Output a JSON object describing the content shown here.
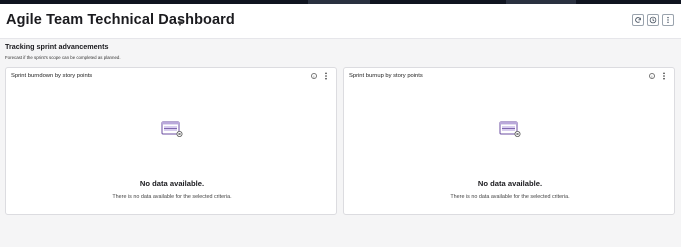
{
  "dashboard": {
    "title": "Agile Team Technical Dashboard",
    "caret_icon": "chevron-down-icon",
    "actions": [
      {
        "icon": "refresh-icon"
      },
      {
        "icon": "clock-icon"
      },
      {
        "icon": "kebab-menu-icon"
      }
    ]
  },
  "section": {
    "title": "Tracking sprint advancements",
    "subtitle": "Forecast if the sprint's scope can be completed as planned."
  },
  "cards": [
    {
      "title": "Sprint burndown by story points",
      "info_icon": "info-icon",
      "menu_icon": "kebab-menu-icon",
      "empty_title": "No data available.",
      "empty_desc": "There is no data available for the selected criteria."
    },
    {
      "title": "Sprint burnup by story points",
      "info_icon": "info-icon",
      "menu_icon": "kebab-menu-icon",
      "empty_title": "No data available.",
      "empty_desc": "There is no data available for the selected criteria."
    }
  ],
  "colors": {
    "background": "#f5f5f6",
    "topbar": "#0f1420",
    "empty_icon_accent": "#6b4ea0"
  }
}
